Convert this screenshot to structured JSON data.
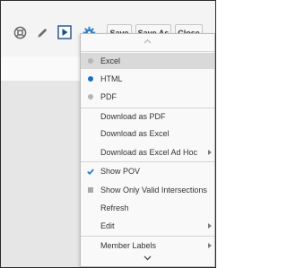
{
  "toolbar": {
    "icons": [
      "lifebuoy-icon",
      "pencil-icon",
      "play-icon",
      "gear-icon"
    ],
    "save_label": "Save",
    "save_as_label": "Save As",
    "close_label": "Close"
  },
  "menu": {
    "items": [
      {
        "label": "Excel",
        "mark": "dot",
        "mark_color": "#b5b5b5",
        "selected": true
      },
      {
        "label": "HTML",
        "mark": "dot",
        "mark_color": "#1a6fc4"
      },
      {
        "label": "PDF",
        "mark": "dot",
        "mark_color": "#b5b5b5"
      },
      {
        "label": "Download as PDF"
      },
      {
        "label": "Download as Excel"
      },
      {
        "label": "Download as Excel Ad Hoc",
        "submenu": true
      },
      {
        "label": "Show POV",
        "mark": "check",
        "mark_color": "#1a6fc4"
      },
      {
        "label": "Show Only Valid Intersections",
        "mark": "square",
        "mark_color": "#a8a8a8"
      },
      {
        "label": "Refresh"
      },
      {
        "label": "Edit",
        "submenu": true
      },
      {
        "label": "Member Labels",
        "submenu": true
      }
    ]
  },
  "colors": {
    "accent": "#1a6fc4",
    "gear": "#2f7fc8"
  }
}
